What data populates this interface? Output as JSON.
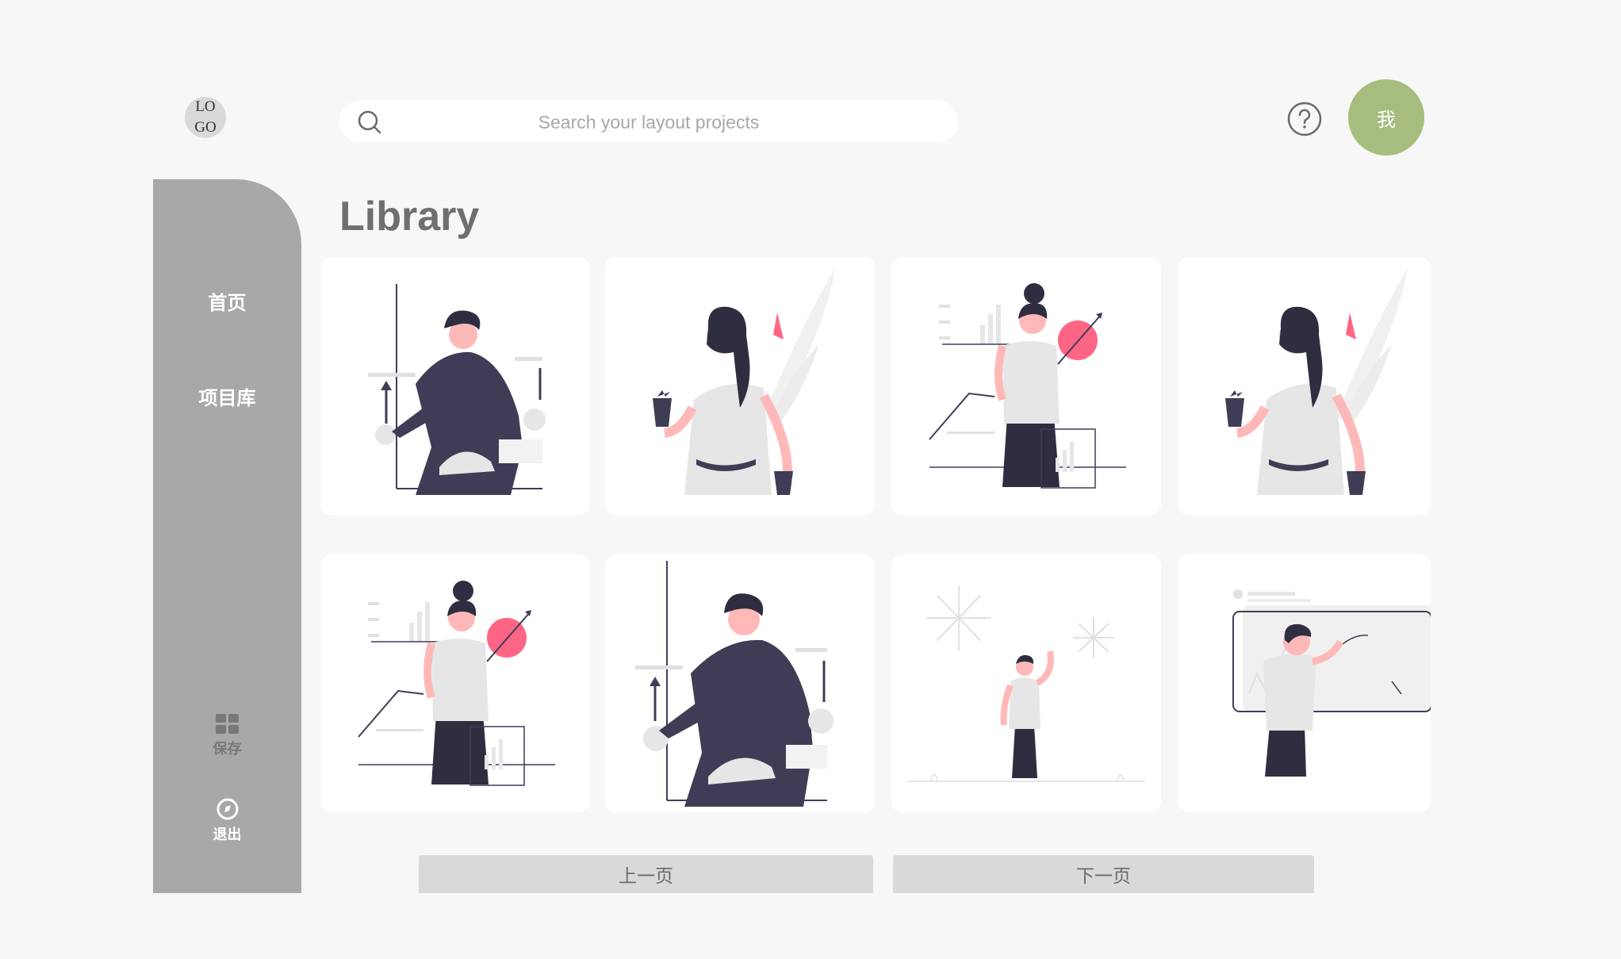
{
  "logo": {
    "line1": "LO",
    "line2": "GO"
  },
  "search": {
    "placeholder": "Search your layout projects",
    "icon": "search-icon"
  },
  "header": {
    "help_icon": "question-circle-icon",
    "avatar_label": "我",
    "avatar_color": "#a6bd7d"
  },
  "sidebar": {
    "items": [
      {
        "label": "首页"
      },
      {
        "label": "项目库"
      }
    ],
    "tools": [
      {
        "label": "保存",
        "icon": "grid-icon"
      },
      {
        "label": "退出",
        "icon": "compass-icon"
      }
    ],
    "color": "#a8a8a8"
  },
  "main": {
    "title": "Library"
  },
  "cards": [
    {
      "illustration": "man-presenting-chart"
    },
    {
      "illustration": "woman-holding-plants"
    },
    {
      "illustration": "woman-with-growth-chart"
    },
    {
      "illustration": "woman-holding-plants"
    },
    {
      "illustration": "woman-with-growth-chart"
    },
    {
      "illustration": "man-presenting-chart"
    },
    {
      "illustration": "man-watching-fireworks"
    },
    {
      "illustration": "man-at-whiteboard"
    }
  ],
  "pagination": {
    "prev_label": "上一页",
    "next_label": "下一页"
  }
}
